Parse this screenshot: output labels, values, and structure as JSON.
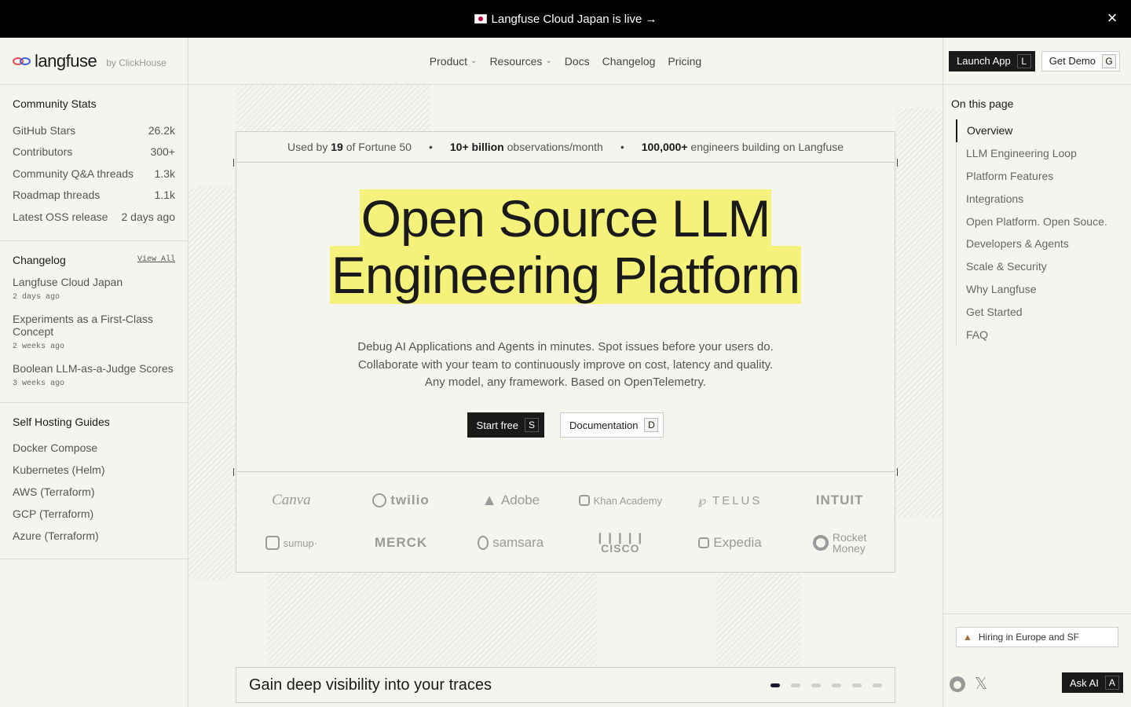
{
  "banner": {
    "text": "Langfuse Cloud Japan is live →",
    "close": "×"
  },
  "brand": {
    "name": "langfuse",
    "by": "by ClickHouse"
  },
  "nav": [
    {
      "label": "Product",
      "dropdown": true
    },
    {
      "label": "Resources",
      "dropdown": true
    },
    {
      "label": "Docs",
      "dropdown": false
    },
    {
      "label": "Changelog",
      "dropdown": false
    },
    {
      "label": "Pricing",
      "dropdown": false
    }
  ],
  "header_actions": {
    "launch": {
      "label": "Launch App",
      "key": "L"
    },
    "demo": {
      "label": "Get Demo",
      "key": "G"
    }
  },
  "community": {
    "title": "Community Stats",
    "rows": [
      {
        "label": "GitHub Stars",
        "value": "26.2k"
      },
      {
        "label": "Contributors",
        "value": "300+"
      },
      {
        "label": "Community Q&A threads",
        "value": "1.3k"
      },
      {
        "label": "Roadmap threads",
        "value": "1.1k"
      },
      {
        "label": "Latest OSS release",
        "value": "2 days ago"
      }
    ]
  },
  "changelog": {
    "title": "Changelog",
    "view_all": "View All",
    "items": [
      {
        "title": "Langfuse Cloud Japan",
        "date": "2 days ago"
      },
      {
        "title": "Experiments as a First-Class Concept",
        "date": "2 weeks ago"
      },
      {
        "title": "Boolean LLM-as-a-Judge Scores",
        "date": "3 weeks ago"
      }
    ]
  },
  "guides": {
    "title": "Self Hosting Guides",
    "items": [
      "Docker Compose",
      "Kubernetes (Helm)",
      "AWS (Terraform)",
      "GCP (Terraform)",
      "Azure (Terraform)"
    ]
  },
  "stats_strip": {
    "a_pre": "Used by",
    "a_bold": "19",
    "a_post": "of Fortune 50",
    "b_bold": "10+ billion",
    "b_post": "observations/month",
    "c_bold": "100,000+",
    "c_post": "engineers building on Langfuse",
    "sep": "•"
  },
  "hero": {
    "line1": "Open Source LLM",
    "line2a": "Engineering",
    "line2b": "Platform",
    "sub1": "Debug AI Applications and Agents in minutes. Spot issues before your users do.",
    "sub2": "Collaborate with your team to continuously improve on cost, latency and quality.",
    "sub3": "Any model, any framework. Based on OpenTelemetry.",
    "start": {
      "label": "Start free",
      "key": "S"
    },
    "docs": {
      "label": "Documentation",
      "key": "D"
    }
  },
  "logos": [
    "Canva",
    "twilio",
    "Adobe",
    "Khan Academy",
    "TELUS",
    "INTUIT",
    "sumup·",
    "MERCK",
    "samsara",
    "CISCO",
    "Expedia",
    "Rocket Money"
  ],
  "logo_lines": {
    "rocket1": "Rocket",
    "rocket2": "Money"
  },
  "toc": {
    "title": "On this page",
    "items": [
      "Overview",
      "LLM Engineering Loop",
      "Platform Features",
      "Integrations",
      "Open Platform. Open Souce.",
      "Developers & Agents",
      "Scale & Security",
      "Why Langfuse",
      "Get Started",
      "FAQ"
    ],
    "active_index": 0
  },
  "hiring": {
    "label": "Hiring in Europe and SF"
  },
  "ask_ai": {
    "label": "Ask AI",
    "key": "A"
  },
  "section": {
    "title": "Gain deep visibility into your traces",
    "pages": 6,
    "active_page": 0
  },
  "icons": [
    "jp-flag-icon",
    "close-icon",
    "chevron-down-icon",
    "github-icon",
    "x-icon",
    "llama-icon"
  ]
}
